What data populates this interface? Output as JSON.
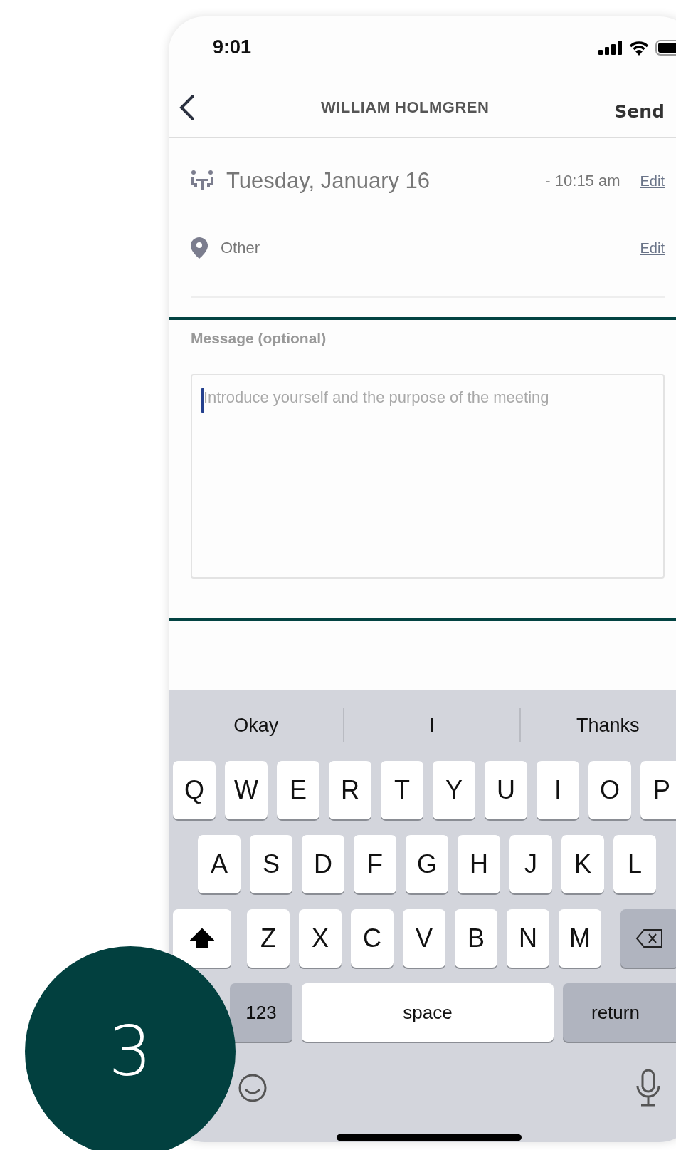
{
  "status_bar": {
    "time": "9:01"
  },
  "nav": {
    "title": "WILLIAM HOLMGREN",
    "action": "Send"
  },
  "schedule": {
    "date": "Tuesday, January 16",
    "time": "- 10:15 am",
    "edit": "Edit"
  },
  "location": {
    "name": "Other",
    "edit": "Edit"
  },
  "message": {
    "label": "Message (optional)",
    "placeholder": "Introduce yourself and the purpose of the meeting",
    "focused": true
  },
  "keyboard": {
    "suggestions": [
      "Okay",
      "I",
      "Thanks"
    ],
    "key_rows": [
      {
        "keys": [
          {
            "kind": "letter",
            "label": "Q"
          },
          {
            "kind": "letter",
            "label": "W"
          },
          {
            "kind": "letter",
            "label": "E"
          },
          {
            "kind": "letter",
            "label": "R"
          },
          {
            "kind": "letter",
            "label": "T"
          },
          {
            "kind": "letter",
            "label": "Y"
          },
          {
            "kind": "letter",
            "label": "U"
          },
          {
            "kind": "letter",
            "label": "I"
          },
          {
            "kind": "letter",
            "label": "O"
          },
          {
            "kind": "letter",
            "label": "P"
          }
        ]
      },
      {
        "keys": [
          {
            "kind": "letter",
            "label": "A"
          },
          {
            "kind": "letter",
            "label": "S"
          },
          {
            "kind": "letter",
            "label": "D"
          },
          {
            "kind": "letter",
            "label": "F"
          },
          {
            "kind": "letter",
            "label": "G"
          },
          {
            "kind": "letter",
            "label": "H"
          },
          {
            "kind": "letter",
            "label": "J"
          },
          {
            "kind": "letter",
            "label": "K"
          },
          {
            "kind": "letter",
            "label": "L"
          }
        ]
      },
      {
        "keys": [
          {
            "kind": "shift",
            "on": true
          },
          {
            "kind": "letter",
            "label": "Z"
          },
          {
            "kind": "letter",
            "label": "X"
          },
          {
            "kind": "letter",
            "label": "C"
          },
          {
            "kind": "letter",
            "label": "V"
          },
          {
            "kind": "letter",
            "label": "B"
          },
          {
            "kind": "letter",
            "label": "N"
          },
          {
            "kind": "letter",
            "label": "M"
          },
          {
            "kind": "delete"
          }
        ]
      },
      {
        "keys": [
          {
            "kind": "mode",
            "label": "123"
          },
          {
            "kind": "space",
            "label": "space"
          },
          {
            "kind": "return",
            "label": "return"
          }
        ]
      }
    ]
  },
  "step_badge": {
    "number": "3"
  }
}
